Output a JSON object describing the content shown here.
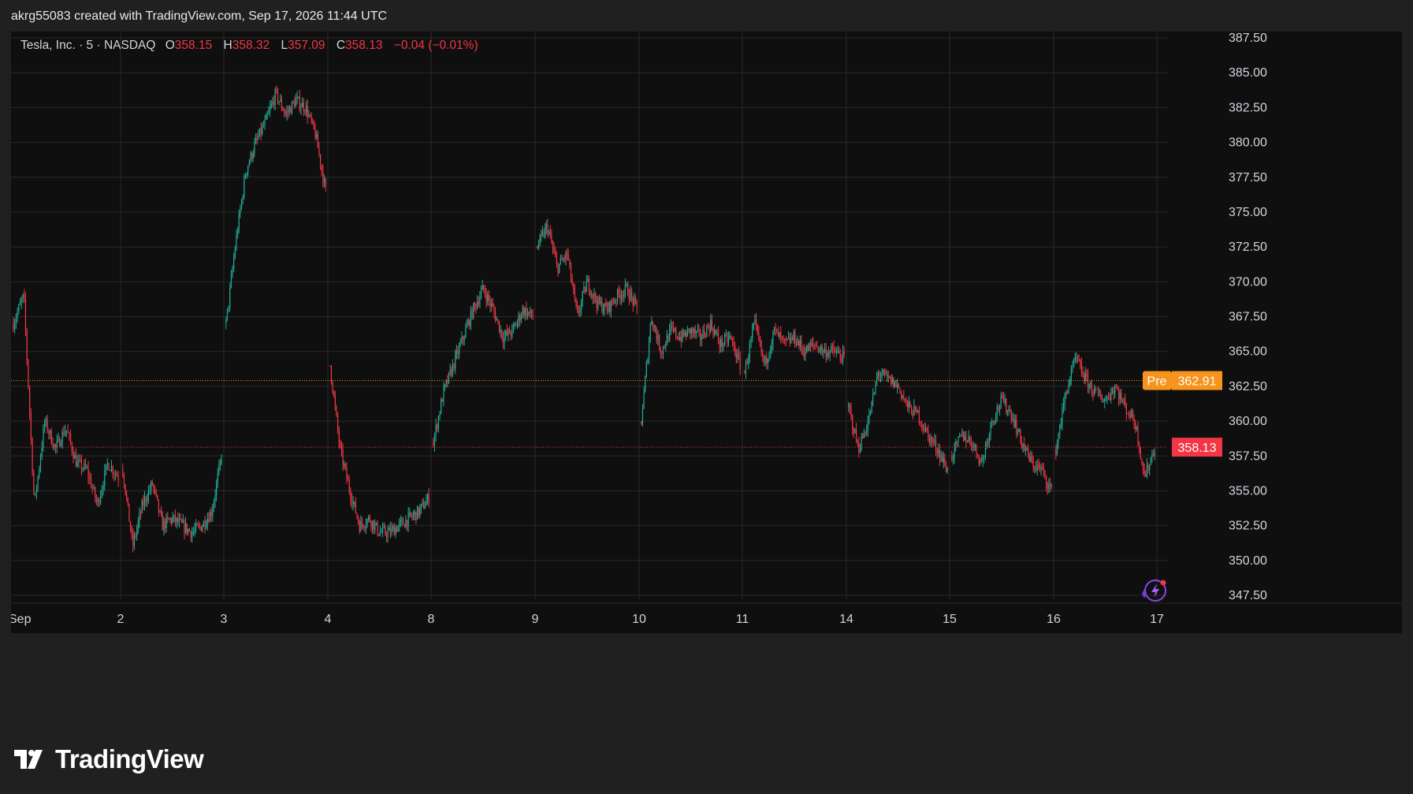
{
  "header": {
    "credit": "akrg55083 created with TradingView.com, Sep 17, 2026 11:44 UTC"
  },
  "legend": {
    "symbol": "Tesla, Inc. · 5 · NASDAQ",
    "o_label": "O",
    "o_value": "358.15",
    "h_label": "H",
    "h_value": "358.32",
    "l_label": "L",
    "l_value": "357.09",
    "c_label": "C",
    "c_value": "358.13",
    "change": "−0.04 (−0.01%)"
  },
  "badges": {
    "pre_label": "Pre",
    "pre_value": "362.91",
    "last_value": "358.13"
  },
  "footer": {
    "brand": "TradingView"
  },
  "colors": {
    "background": "#0f0f0f",
    "page": "#202020",
    "grid": "#2a2a2a",
    "up": "#22ab94",
    "down": "#f23645",
    "pre": "#f7941d",
    "text": "#d1d4dc"
  },
  "icons": {
    "logo": "tradingview-logo-icon",
    "assistant": "lightning-spark-icon"
  },
  "chart_data": {
    "type": "candlestick",
    "title": "Tesla, Inc. · 5 · NASDAQ",
    "interval": "5",
    "y_ticks": [
      "387.50",
      "385.00",
      "382.50",
      "380.00",
      "377.50",
      "375.00",
      "372.50",
      "370.00",
      "367.50",
      "365.00",
      "362.50",
      "360.00",
      "357.50",
      "355.00",
      "352.50",
      "350.00",
      "347.50"
    ],
    "ylim": [
      346.5,
      388.5
    ],
    "x_tick_labels": [
      "Sep",
      "2",
      "3",
      "4",
      "8",
      "9",
      "10",
      "11",
      "14",
      "15",
      "16",
      "17"
    ],
    "pre_market_price": 362.91,
    "last_price": 358.13,
    "grid": true,
    "sessions": [
      {
        "day": "Sep",
        "open": 367.0,
        "path": [
          369,
          354,
          360,
          358,
          359.5,
          357,
          356.5,
          354,
          357,
          356
        ]
      },
      {
        "day": "2",
        "open": 356.5,
        "path": [
          351,
          354,
          355.5,
          352.5,
          353,
          352.5,
          352,
          352.5,
          353.5,
          357.5
        ]
      },
      {
        "day": "3",
        "open": 367.0,
        "path": [
          373,
          378,
          380,
          381.5,
          383.5,
          382,
          383,
          382.5,
          380.5,
          376.5
        ]
      },
      {
        "day": "4",
        "open": 364.0,
        "path": [
          358,
          355,
          352.5,
          353,
          352,
          352,
          352.5,
          353,
          353.5,
          354.5
        ]
      },
      {
        "day": "8",
        "open": 358.5,
        "path": [
          362,
          364,
          366,
          368,
          369.5,
          368,
          366,
          366.5,
          368,
          367.5
        ]
      },
      {
        "day": "9",
        "open": 372.5,
        "path": [
          374,
          371,
          372,
          367.5,
          370,
          368.5,
          368,
          369,
          369.5,
          368
        ]
      },
      {
        "day": "10",
        "open": 360.0,
        "path": [
          367.5,
          365,
          366.5,
          366,
          366.5,
          366,
          367,
          365.5,
          366,
          364
        ]
      },
      {
        "day": "11",
        "open": 363.5,
        "path": [
          367,
          364,
          366.5,
          365.5,
          366,
          365,
          365.5,
          365,
          365,
          364.5
        ]
      },
      {
        "day": "14",
        "open": 361.0,
        "path": [
          358,
          360,
          363.5,
          363,
          362.5,
          361,
          360.5,
          359,
          358,
          356.5
        ]
      },
      {
        "day": "15",
        "open": 357.5,
        "path": [
          359,
          358.5,
          357,
          360,
          361.5,
          360.5,
          358.5,
          357,
          356.5,
          355
        ]
      },
      {
        "day": "16",
        "open": 358.0,
        "path": [
          362,
          364.5,
          363,
          362,
          361.5,
          362.5,
          361,
          360,
          356,
          358.13
        ]
      }
    ]
  }
}
